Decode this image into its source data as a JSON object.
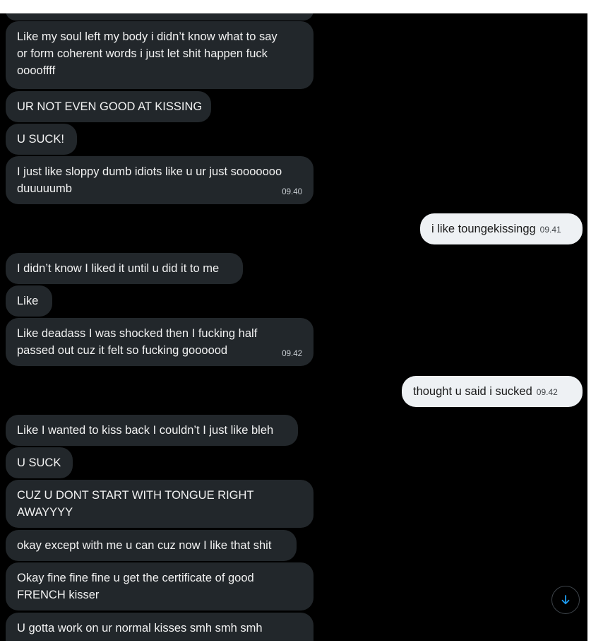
{
  "messages": [
    {
      "id": "m1",
      "dir": "in",
      "lines": [
        "Like my soul left my body i didn’t know what to say",
        "or form coherent words i just let shit happen fuck",
        "ooooffff"
      ],
      "time": ""
    },
    {
      "id": "m2",
      "dir": "in",
      "lines": [
        "UR NOT EVEN GOOD AT KISSING"
      ],
      "time": ""
    },
    {
      "id": "m3",
      "dir": "in",
      "lines": [
        "U SUCK!"
      ],
      "time": ""
    },
    {
      "id": "m4",
      "dir": "in",
      "lines": [
        "I just like sloppy dumb idiots like u ur just sooooooo",
        "duuuuumb"
      ],
      "time": "09.40"
    },
    {
      "id": "m5",
      "dir": "out",
      "lines": [
        "i like toungekissingg"
      ],
      "time": "09.41"
    },
    {
      "id": "m6",
      "dir": "in",
      "lines": [
        "I didn’t know I liked it until u did it to me"
      ],
      "time": ""
    },
    {
      "id": "m7",
      "dir": "in",
      "lines": [
        "Like"
      ],
      "time": ""
    },
    {
      "id": "m8",
      "dir": "in",
      "lines": [
        "Like deadass I was shocked then I fucking half",
        "passed out cuz it felt so fucking goooood"
      ],
      "time": "09.42"
    },
    {
      "id": "m9",
      "dir": "out",
      "lines": [
        "thought u said i sucked"
      ],
      "time": "09.42"
    },
    {
      "id": "m10",
      "dir": "in",
      "lines": [
        "Like I wanted to kiss back I couldn’t I just like bleh"
      ],
      "time": ""
    },
    {
      "id": "m11",
      "dir": "in",
      "lines": [
        "U SUCK"
      ],
      "time": ""
    },
    {
      "id": "m12",
      "dir": "in",
      "lines": [
        "CUZ U DONT START WITH TONGUE RIGHT",
        "AWAYYYY"
      ],
      "time": ""
    },
    {
      "id": "m13",
      "dir": "in",
      "lines": [
        "okay except with me u can cuz now I like that shit"
      ],
      "time": ""
    },
    {
      "id": "m14",
      "dir": "in",
      "lines": [
        "Okay fine fine fine u get the certificate of good",
        "FRENCH kisser"
      ],
      "time": ""
    },
    {
      "id": "m15",
      "dir": "in",
      "lines": [
        "U gotta work on ur normal kisses smh smh smh"
      ],
      "time": ""
    }
  ],
  "scroll_button": {
    "icon": "arrow-down-icon",
    "color": "#1d9bf0"
  },
  "colors": {
    "background": "#000000",
    "incoming_bubble": "#22272b",
    "outgoing_bubble": "#eef1f4",
    "text": "#f2f2f2"
  }
}
